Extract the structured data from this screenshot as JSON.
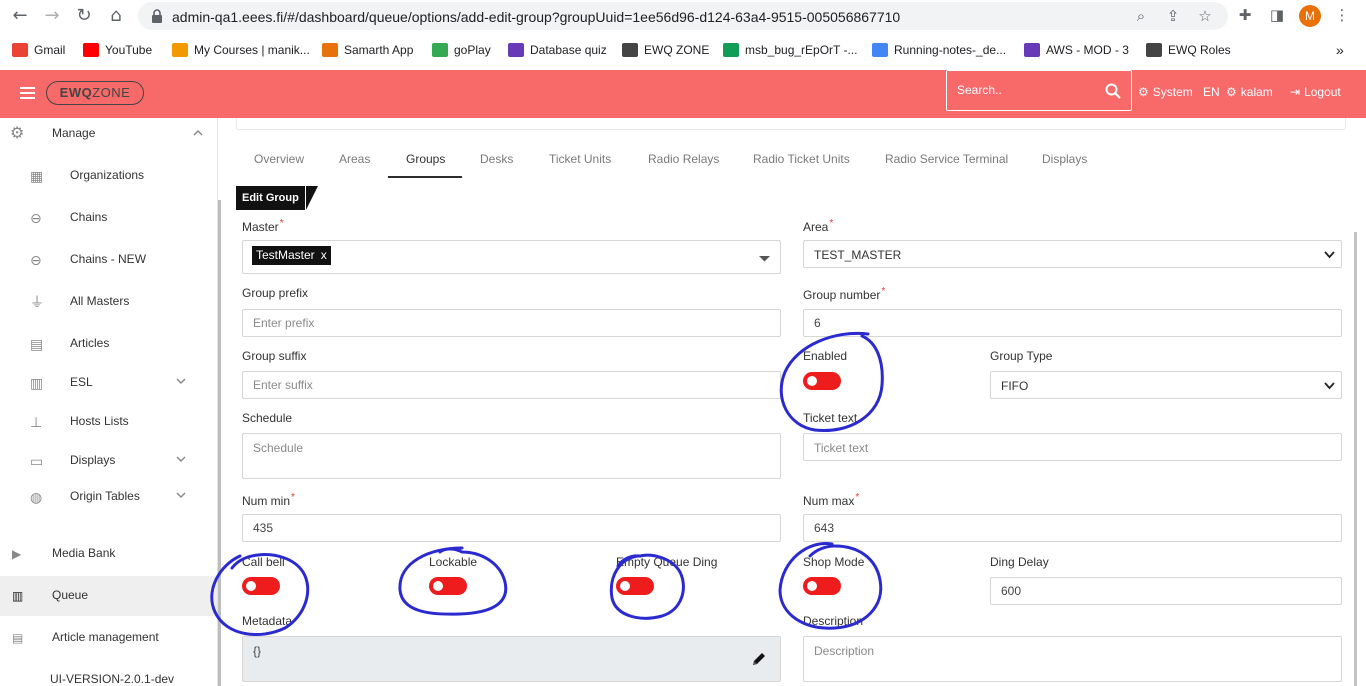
{
  "browser": {
    "url": "admin-qa1.eees.fi/#/dashboard/queue/options/add-edit-group?groupUuid=1ee56d96-d124-63a4-9515-005056867710",
    "profile_initial": "M",
    "bookmarks": [
      {
        "label": "Gmail",
        "icon": "gmail-icon",
        "color": "#ea4335"
      },
      {
        "label": "YouTube",
        "icon": "youtube-icon",
        "color": "#ff0000"
      },
      {
        "label": "My Courses | manik...",
        "icon": "courses-icon",
        "color": "#f29900"
      },
      {
        "label": "Samarth App",
        "icon": "samarth-icon",
        "color": "#e8710a"
      },
      {
        "label": "goPlay",
        "icon": "goplay-icon",
        "color": "#34a853"
      },
      {
        "label": "Database quiz",
        "icon": "forms-icon",
        "color": "#673ab7"
      },
      {
        "label": "EWQ ZONE",
        "icon": "ewq-icon",
        "color": "#444444"
      },
      {
        "label": "msb_bug_rEpOrT -...",
        "icon": "sheets-icon",
        "color": "#0f9d58"
      },
      {
        "label": "Running-notes-_de...",
        "icon": "docs-icon",
        "color": "#4285f4"
      },
      {
        "label": "AWS - MOD - 3",
        "icon": "forms-icon",
        "color": "#673ab7"
      },
      {
        "label": "EWQ Roles",
        "icon": "ewq-icon",
        "color": "#444444"
      }
    ],
    "more_bookmarks": "»"
  },
  "header": {
    "logo_bold": "EWQ",
    "logo_thin": "ZONE",
    "search_placeholder": "Search..",
    "system_label": "System",
    "language": "EN",
    "user": "kalam",
    "logout_label": "Logout",
    "color": "#f86a6a"
  },
  "sidebar": {
    "manage_label": "Manage",
    "items": [
      {
        "label": "Organizations",
        "icon": "building-icon"
      },
      {
        "label": "Chains",
        "icon": "link-icon"
      },
      {
        "label": "Chains - NEW",
        "icon": "link-icon"
      },
      {
        "label": "All Masters",
        "icon": "router-icon"
      },
      {
        "label": "Articles",
        "icon": "archive-icon"
      },
      {
        "label": "ESL",
        "icon": "server-icon",
        "expandable": true
      },
      {
        "label": "Hosts Lists",
        "icon": "sitemap-icon"
      },
      {
        "label": "Displays",
        "icon": "monitor-icon",
        "expandable": true
      },
      {
        "label": "Origin Tables",
        "icon": "globe-icon",
        "expandable": true
      }
    ],
    "sections": [
      {
        "label": "Media Bank",
        "icon": "play-circle-icon"
      },
      {
        "label": "Queue",
        "icon": "chart-bar-icon",
        "active": true
      },
      {
        "label": "Article management",
        "icon": "table-icon"
      }
    ],
    "version": "UI-VERSION-2.0.1-dev"
  },
  "tabs": [
    "Overview",
    "Areas",
    "Groups",
    "Desks",
    "Ticket Units",
    "Radio Relays",
    "Radio Ticket Units",
    "Radio Service Terminal",
    "Displays"
  ],
  "active_tab": "Groups",
  "form": {
    "title": "Edit Group",
    "master_label": "Master",
    "master_value": "TestMaster",
    "master_remove": "x",
    "area_label": "Area",
    "area_value": "TEST_MASTER",
    "group_prefix_label": "Group prefix",
    "group_prefix_placeholder": "Enter prefix",
    "group_number_label": "Group number",
    "group_number_value": "6",
    "group_suffix_label": "Group suffix",
    "group_suffix_placeholder": "Enter suffix",
    "enabled_label": "Enabled",
    "enabled_on": false,
    "group_type_label": "Group Type",
    "group_type_value": "FIFO",
    "schedule_label": "Schedule",
    "schedule_placeholder": "Schedule",
    "ticket_text_label": "Ticket text",
    "ticket_text_placeholder": "Ticket text",
    "num_min_label": "Num min",
    "num_min_value": "435",
    "num_max_label": "Num max",
    "num_max_value": "643",
    "call_bell_label": "Call bell",
    "lockable_label": "Lockable",
    "empty_queue_ding_label": "Empty Queue Ding",
    "shop_mode_label": "Shop Mode",
    "ding_delay_label": "Ding Delay",
    "ding_delay_value": "600",
    "metadata_label": "Metadata",
    "metadata_value": "{}",
    "description_label": "Description",
    "description_placeholder": "Description",
    "toggle_color": "#ee1c1c"
  },
  "annotation_color": "#2a2ad0"
}
